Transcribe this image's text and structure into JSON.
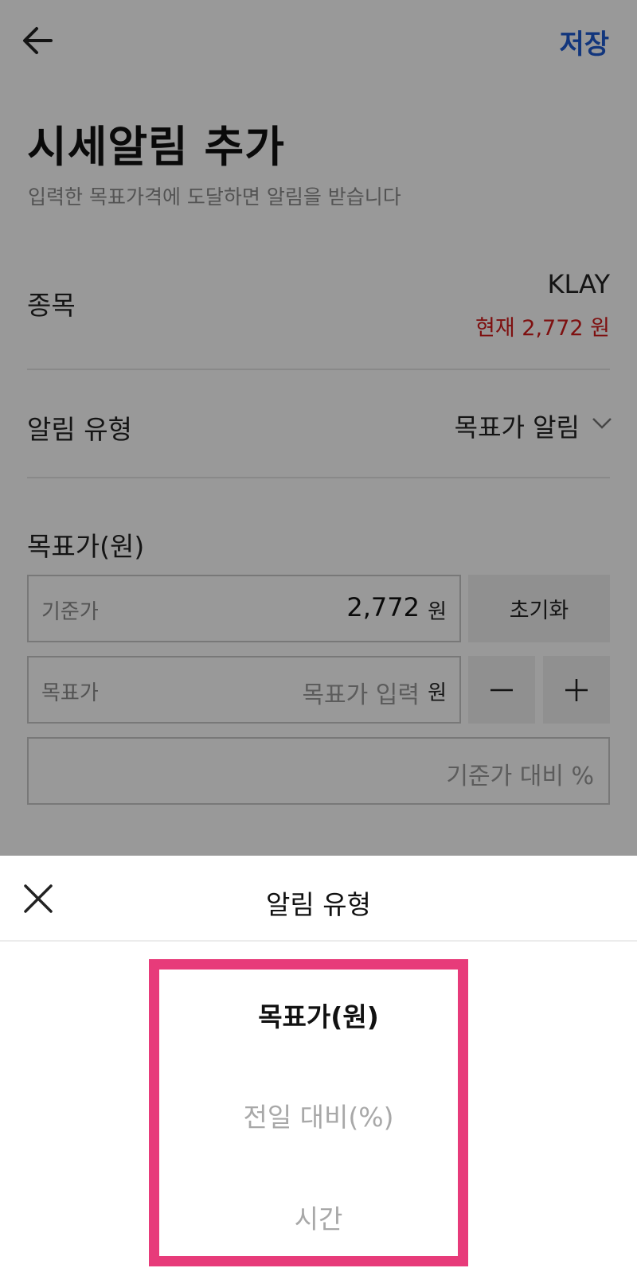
{
  "header": {
    "save_label": "저장"
  },
  "page": {
    "title": "시세알림 추가",
    "subtitle": "입력한 목표가격에 도달하면 알림을 받습니다"
  },
  "item": {
    "label": "종목",
    "symbol": "KLAY",
    "current_price": "현재 2,772 원"
  },
  "alert_type": {
    "label": "알림 유형",
    "value": "목표가 알림"
  },
  "target": {
    "label": "목표가(원)",
    "base_label": "기준가",
    "base_value": "2,772",
    "unit": "원",
    "reset_label": "초기화",
    "target_label": "목표가",
    "target_placeholder": "목표가 입력",
    "percent_placeholder": "기준가 대비 %"
  },
  "sheet": {
    "title": "알림 유형",
    "options": [
      "목표가(원)",
      "전일 대비(%)",
      "시간"
    ],
    "selected_index": 0
  },
  "colors": {
    "accent": "#1e5bd1",
    "price_red": "#d21c1c",
    "highlight": "#e73b7a"
  },
  "icons": {
    "back": "arrow-left-icon",
    "chevron": "chevron-down-icon",
    "minus": "minus-icon",
    "plus": "plus-icon",
    "close": "close-icon"
  }
}
